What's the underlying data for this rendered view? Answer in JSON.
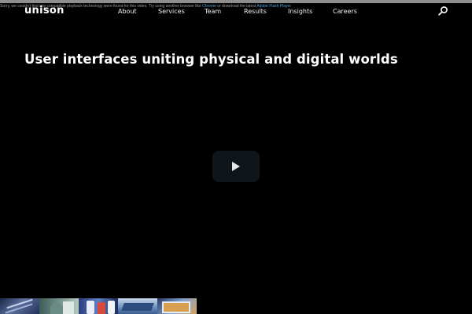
{
  "notice": {
    "text_before": "Sorry, we couldn't find any compatible playback technology were found for this video. Try using another browser like",
    "browser_link": "Chrome",
    "text_middle": "or download the latest",
    "player_link": "Adobe Flash Player"
  },
  "brand": {
    "logo": "unison"
  },
  "nav": {
    "items": [
      {
        "label": "About"
      },
      {
        "label": "Services"
      },
      {
        "label": "Team"
      },
      {
        "label": "Results"
      },
      {
        "label": "Insights"
      },
      {
        "label": "Careers"
      }
    ],
    "search_icon": "search-icon"
  },
  "hero": {
    "headline": "User interfaces uniting physical and digital worlds",
    "play_icon": "play-icon"
  },
  "colors": {
    "background": "#000000",
    "play_button": "#0f1519",
    "link": "#4fa3d8"
  }
}
